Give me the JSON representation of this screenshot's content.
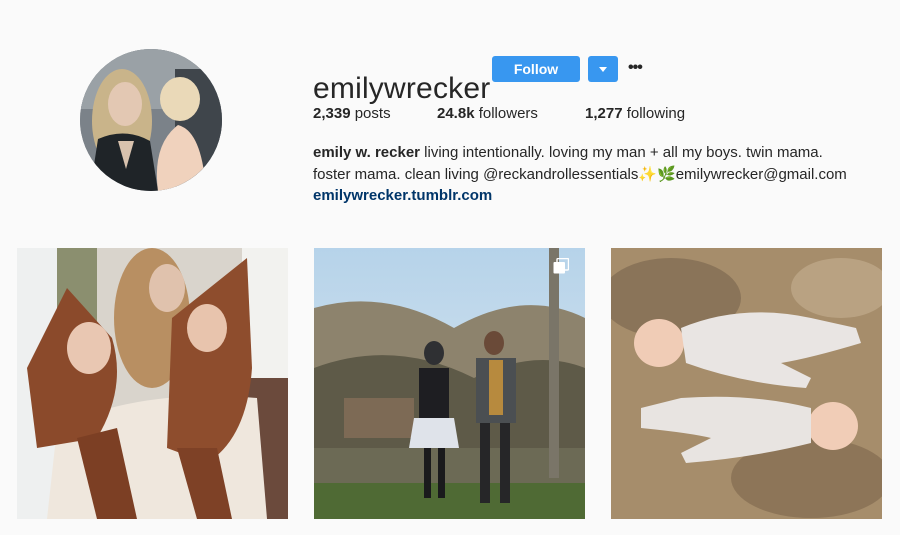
{
  "profile": {
    "username": "emilywrecker",
    "follow_label": "Follow",
    "more_label": "•••"
  },
  "stats": {
    "posts_count": "2,339",
    "posts_label": " posts",
    "followers_count": "24.8k",
    "followers_label": " followers",
    "following_count": "1,277",
    "following_label": " following"
  },
  "bio": {
    "full_name": "emily w. recker",
    "line1_rest": " living intentionally. loving my man + all my boys. twin mama.",
    "line2": "foster mama. clean living @reckandrollessentials✨🌿emilywrecker@gmail.com",
    "website": "emilywrecker.tumblr.com"
  },
  "colors": {
    "accent": "#3897f0",
    "link": "#003569",
    "background": "#fafafa"
  },
  "icons": {
    "dropdown": "chevron-down-icon",
    "more": "more-options-icon",
    "multi_post": "multiple-photos-icon"
  }
}
